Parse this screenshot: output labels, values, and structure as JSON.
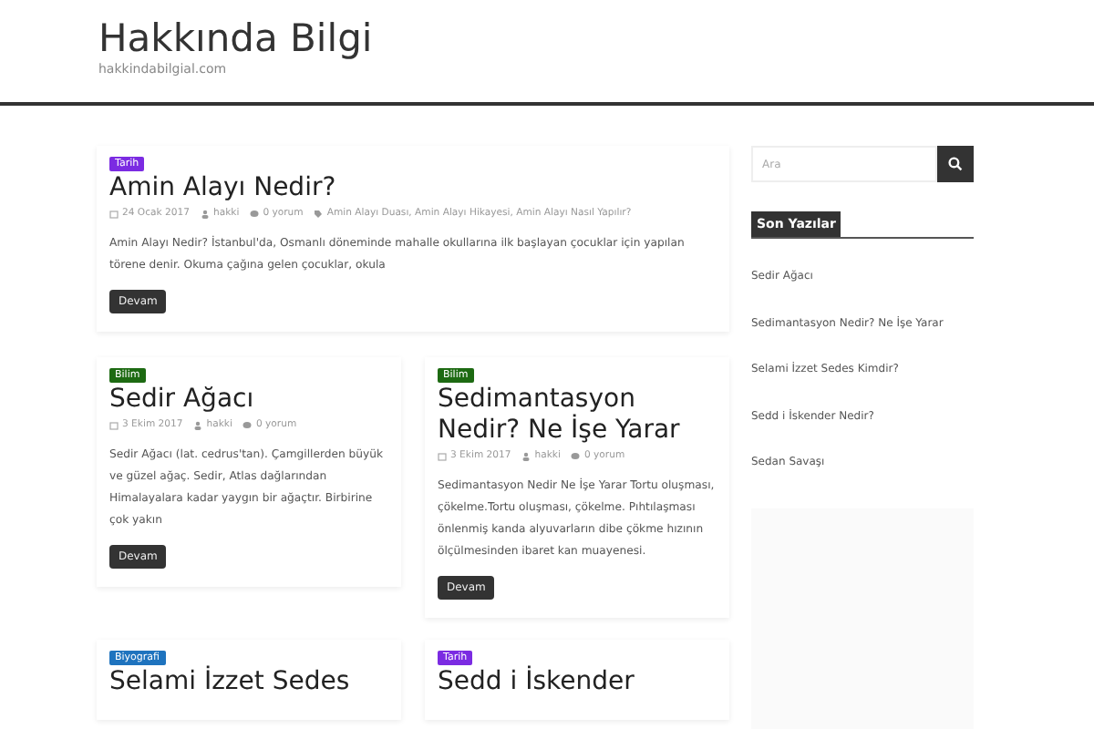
{
  "site": {
    "title": "Hakkında Bilgi",
    "tagline": "hakkindabilgial.com"
  },
  "posts": [
    {
      "category": {
        "label": "Tarih",
        "color": "#7b2be2"
      },
      "title": "Amin Alayı Nedir?",
      "date": "24 Ocak 2017",
      "author": "hakki",
      "comments": "0 yorum",
      "tags": "Amin Alayı Duası, Amin Alayı Hikayesi, Amin Alayı Nasıl Yapılır?",
      "excerpt": "Amin Alayı Nedir? İstanbul'da, Osmanlı döneminde mahalle okullarına ilk başlayan çocuklar için yapılan törene denir. Okuma çağına gelen çocuklar, okula",
      "button": "Devam"
    },
    {
      "category": {
        "label": "Bilim",
        "color": "#1d6a12"
      },
      "title": "Sedir Ağacı",
      "date": "3 Ekim 2017",
      "author": "hakki",
      "comments": "0 yorum",
      "excerpt": "Sedir Ağacı (lat. cedrus'tan). Çamgillerden büyük ve güzel ağaç. Sedir, Atlas dağlarından Himalayalara kadar yaygın bir ağaçtır. Birbirine çok yakın",
      "button": "Devam"
    },
    {
      "category": {
        "label": "Bilim",
        "color": "#1d6a12"
      },
      "title": "Sedimantasyon Nedir? Ne İşe Yarar",
      "date": "3 Ekim 2017",
      "author": "hakki",
      "comments": "0 yorum",
      "excerpt": "Sedimantasyon Nedir Ne İşe Yarar Tortu oluşması, çökelme.Tortu oluşması, çökelme. Pıhtılaşması önlenmiş kanda alyuvarların dibe çökme hızının ölçülmesinden ibaret kan muayenesi.",
      "button": "Devam"
    },
    {
      "category": {
        "label": "Biyografi",
        "color": "#1e73be"
      },
      "title": "Selami İzzet Sedes"
    },
    {
      "category": {
        "label": "Tarih",
        "color": "#7b2be2"
      },
      "title": "Sedd i İskender"
    }
  ],
  "sidebar": {
    "search": {
      "placeholder": "Ara"
    },
    "widget_title": "Son Yazılar",
    "recent": [
      "Sedir Ağacı",
      "Sedimantasyon Nedir? Ne İşe Yarar",
      "Selami İzzet Sedes Kimdir?",
      "Sedd i İskender Nedir?",
      "Sedan Savaşı"
    ]
  }
}
